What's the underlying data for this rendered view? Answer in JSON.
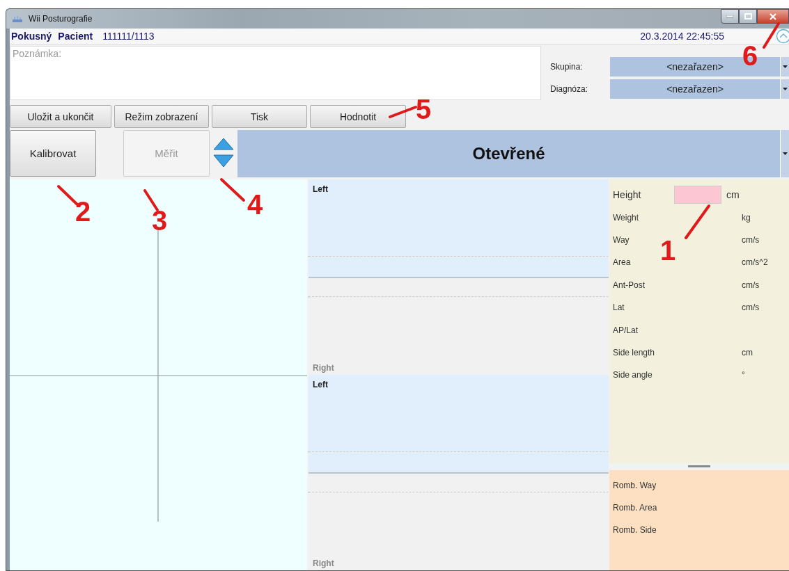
{
  "window": {
    "title": "Wii Posturografie"
  },
  "patient": {
    "first_name": "Pokusný",
    "last_name": "Pacient",
    "id": "111111/1113",
    "datetime": "20.3.2014 22:45:55"
  },
  "note": {
    "placeholder": "Poznámka:"
  },
  "selectors": [
    {
      "label": "Skupina:",
      "value": "<nezařazen>"
    },
    {
      "label": "Diagnóza:",
      "value": "<nezařazen>"
    }
  ],
  "toolbar_buttons": [
    "Uložit a ukončit",
    "Režim zobrazení",
    "Tisk",
    "Hodnotit"
  ],
  "measure_buttons": [
    {
      "label": "Kalibrovat",
      "disabled": false
    },
    {
      "label": "Měřit",
      "disabled": true
    }
  ],
  "mode": {
    "value": "Otevřené"
  },
  "charts": [
    {
      "top_label": "Left",
      "bottom_label": "Right"
    },
    {
      "top_label": "Left",
      "bottom_label": "Right"
    }
  ],
  "stats": [
    {
      "label": "Height",
      "unit": "cm",
      "kind": "input"
    },
    {
      "label": "Weight",
      "unit": "kg",
      "kind": "text"
    },
    {
      "label": "Way",
      "unit": "cm/s",
      "kind": "text"
    },
    {
      "label": "Area",
      "unit": "cm/s^2",
      "kind": "text"
    },
    {
      "label": "Ant-Post",
      "unit": "cm/s",
      "kind": "text"
    },
    {
      "label": "Lat",
      "unit": "cm/s",
      "kind": "text"
    },
    {
      "label": "AP/Lat",
      "kind": "text"
    },
    {
      "label": "Side length",
      "unit": "cm",
      "kind": "text"
    },
    {
      "label": "Side angle",
      "unit": "°",
      "kind": "text"
    }
  ],
  "romberg": [
    "Romb. Way",
    "Romb. Area",
    "Romb. Side"
  ],
  "annotations": [
    "1",
    "2",
    "3",
    "4",
    "5",
    "6"
  ]
}
